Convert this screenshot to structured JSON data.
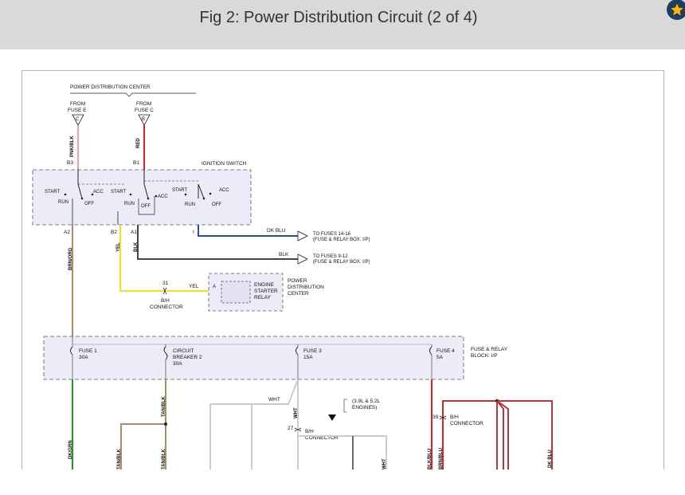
{
  "header": {
    "title": "Fig 2: Power Distribution Circuit (2 of 4)",
    "icon": "star-icon",
    "star_color": "#f2b51c"
  },
  "diagram": {
    "pdc": {
      "label": "POWER DISTRIBUTION CENTER",
      "from_fuse_e": [
        "FROM",
        "FUSE E"
      ],
      "from_fuse_c": [
        "FROM",
        "FUSE C"
      ],
      "conn_e": "C",
      "conn_c": "B"
    },
    "wires": {
      "pnk_blk": "PNK/BLK",
      "red": "RED",
      "brn_org": "BRN/ORG",
      "yel": "YEL",
      "blk": "BLK",
      "dk_blu": "DK BLU",
      "dk_grn": "DK/GRN",
      "tan_blk": "TAN/BLK",
      "wht": "WHT",
      "blk_blu": "BLK/BLU",
      "brn_blu": "BRN/BLU",
      "dk_blu2": "DK BLU"
    },
    "ignition_switch": {
      "label": "IGNITION SWITCH",
      "pins": {
        "b3": "B3",
        "b1": "B1",
        "a2": "A2",
        "b2": "B2",
        "a1": "A1",
        "i": "I"
      },
      "start": "START",
      "acc": "ACC",
      "run": "RUN",
      "off": "OFF"
    },
    "outputs": {
      "fuses_14_16": [
        "TO FUSES 14-16",
        "(FUSE & RELAY BOX: I/P)"
      ],
      "fuses_9_12": [
        "TO FUSES 9-12",
        "(FUSE & RELAY BOX: I/P)"
      ]
    },
    "starter": {
      "pin_31": "31",
      "wire": "YEL",
      "connector": [
        "B/H",
        "CONNECTOR"
      ],
      "relay_pin": "A",
      "relay": [
        "ENGINE",
        "STARTER",
        "RELAY"
      ],
      "pdc": [
        "POWER",
        "DISTRIBUTION",
        "CENTER"
      ]
    },
    "fuse_block": {
      "label": [
        "FUSE & RELAY",
        "BLOCK: I/P"
      ],
      "fuse1": [
        "FUSE 1",
        "30A"
      ],
      "cb2": [
        "CIRCUIT",
        "BREAKER 2",
        "30A"
      ],
      "fuse3": [
        "FUSE 3",
        "15A"
      ],
      "fuse4": [
        "FUSE 4",
        "5A"
      ]
    },
    "lower": {
      "engines_note": [
        "(3.9L & 5.2L",
        "ENGINES)"
      ],
      "pin_39": "39",
      "conn_39": [
        "B/H",
        "CONNECTOR"
      ],
      "pin_27": "27",
      "conn_27": [
        "B/H",
        "CONNECTOR"
      ],
      "wht_top": "WHT"
    }
  },
  "colors": {
    "wire_pink": "#e8a0b0",
    "wire_red": "#e02020",
    "wire_brown": "#b08a60",
    "wire_yellow": "#f0e020",
    "wire_black": "#444444",
    "wire_dkblue": "#2a4fa8",
    "wire_green": "#1f9a2a",
    "wire_white": "#cccccc",
    "wire_darkred": "#c03040",
    "box_fill": "#ececf8"
  }
}
